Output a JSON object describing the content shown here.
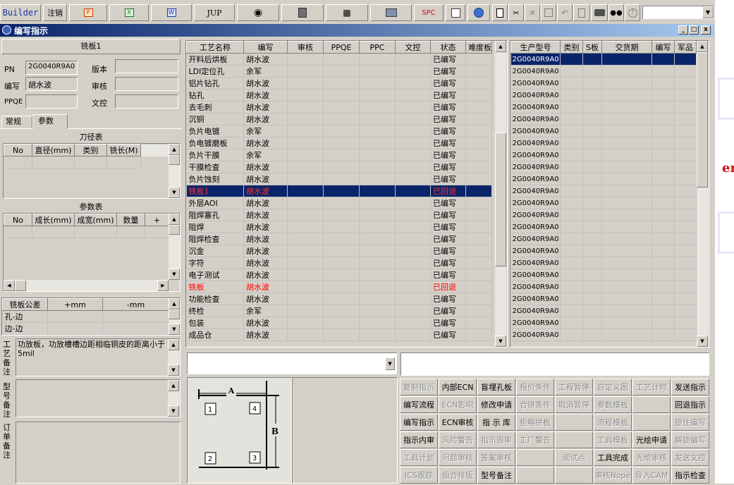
{
  "toolbar": {
    "builder": "Builder",
    "logout": "注销",
    "jup": "JUP",
    "spc": "SPC"
  },
  "window": {
    "title": "编写指示",
    "min": "_",
    "max": "□",
    "close": "x"
  },
  "left": {
    "header": "铣板1",
    "pn_label": "PN",
    "pn_value": "2G0040R9A0",
    "version_label": "版本",
    "version_value": "",
    "writer_label": "编写",
    "writer_value": "胡水波",
    "review_label": "审核",
    "review_value": "",
    "ppqe_label": "PPQE",
    "ppqe_value": "",
    "doc_label": "文控",
    "doc_value": "",
    "tabs": [
      "常规",
      "参数"
    ],
    "tool_title": "刀径表",
    "tool_cols": [
      "No",
      "直径(mm)",
      "类别",
      "铣长(M)"
    ],
    "param_title": "参数表",
    "param_cols": [
      "No",
      "成长(mm)",
      "成宽(mm)",
      "数量",
      "+"
    ],
    "tol_cols": [
      "铣板公差",
      "+mm",
      "-mm"
    ],
    "tol_rows": [
      "孔-边",
      "边-边"
    ],
    "process_note_label": "工艺备注",
    "process_note": "功放板，功放槽槽边距相临铜皮的距离小于5mil",
    "model_note_label": "型号备注",
    "order_note_label": "订单备注"
  },
  "process_table": {
    "cols": [
      "工艺名称",
      "编写",
      "审核",
      "PPQE",
      "PPC",
      "文控",
      "状态",
      "难度板"
    ],
    "rows": [
      [
        "开料后烘板",
        "胡水波",
        "已编写"
      ],
      [
        "LDI定位孔",
        "余军",
        "已编写"
      ],
      [
        "铝片钻孔",
        "胡水波",
        "已编写"
      ],
      [
        "钻孔",
        "胡水波",
        "已编写"
      ],
      [
        "去毛刺",
        "胡水波",
        "已编写"
      ],
      [
        "沉铜",
        "胡水波",
        "已编写"
      ],
      [
        "负片电镀",
        "余军",
        "已编写"
      ],
      [
        "负电镀磨板",
        "胡水波",
        "已编写"
      ],
      [
        "负片干膜",
        "余军",
        "已编写"
      ],
      [
        "干膜检查",
        "胡水波",
        "已编写"
      ],
      [
        "负片蚀刻",
        "胡水波",
        "已编写"
      ],
      [
        "铣板1",
        "胡水波",
        "已回退"
      ],
      [
        "外层AOI",
        "胡水波",
        "已编写"
      ],
      [
        "阻焊塞孔",
        "胡水波",
        "已编写"
      ],
      [
        "阻焊",
        "胡水波",
        "已编写"
      ],
      [
        "阻焊检查",
        "胡水波",
        "已编写"
      ],
      [
        "沉金",
        "胡水波",
        "已编写"
      ],
      [
        "字符",
        "胡水波",
        "已编写"
      ],
      [
        "电子测试",
        "胡水波",
        "已编写"
      ],
      [
        "铣板",
        "胡水波",
        "已回退"
      ],
      [
        "功能检查",
        "胡水波",
        "已编写"
      ],
      [
        "终检",
        "余军",
        "已编写"
      ],
      [
        "包装",
        "胡水波",
        "已编写"
      ],
      [
        "成品仓",
        "胡水波",
        "已编写"
      ]
    ]
  },
  "model_table": {
    "cols": [
      "生产型号",
      "类别",
      "S板",
      "交货期",
      "编写",
      "军品"
    ],
    "value": "2G0040R9A0",
    "count": 24
  },
  "diagram": {
    "a": "A",
    "b": "B",
    "n1": "1",
    "n2": "2",
    "n3": "3",
    "n4": "4"
  },
  "actions": [
    [
      "复制指示",
      "内部ECN",
      "盲埋孔板",
      "报价条件",
      "工程暂停",
      "自定义图",
      "工艺计时",
      "发送指示"
    ],
    [
      "编写流程",
      "ECN影响",
      "修改申请",
      "合拼条件",
      "取消暂停",
      "参数模板",
      "",
      "回退指示"
    ],
    [
      "编写指示",
      "ECN审核",
      "指 示 库",
      "拒略拼板",
      "",
      "流程模板",
      "",
      "锁住编写"
    ],
    [
      "指示内审",
      "风险警告",
      "指示退审",
      "工厂警告",
      "",
      "工具模板",
      "光绘申请",
      "解锁编写"
    ],
    [
      "工具计划",
      "问题审核",
      "答案审核",
      "",
      "测试点",
      "工具完成",
      "光绘审核",
      "发送文控"
    ],
    [
      "ICS跟踪",
      "组合排版",
      "型号备注",
      "",
      "",
      "审核Nope",
      "导入CAM",
      "指示检查"
    ]
  ],
  "actions_enabled": [
    [
      0,
      1,
      1,
      0,
      0,
      0,
      0,
      1
    ],
    [
      1,
      0,
      1,
      0,
      0,
      0,
      0,
      1
    ],
    [
      1,
      1,
      1,
      0,
      0,
      0,
      0,
      0
    ],
    [
      1,
      0,
      0,
      0,
      0,
      0,
      1,
      0
    ],
    [
      0,
      0,
      0,
      0,
      0,
      1,
      0,
      0
    ],
    [
      0,
      0,
      1,
      0,
      0,
      0,
      0,
      1
    ]
  ]
}
